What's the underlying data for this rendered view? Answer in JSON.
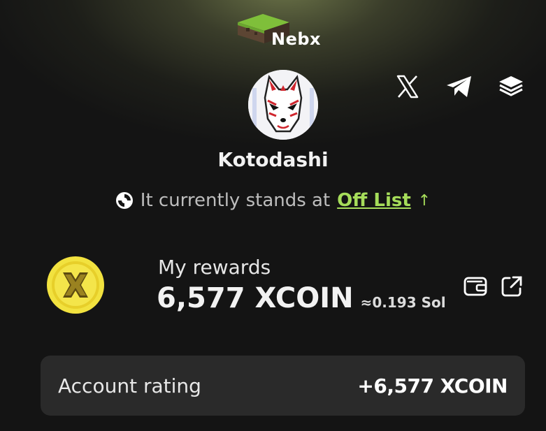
{
  "brand": {
    "name": "Nebx",
    "logo_icon": "grass-block-icon"
  },
  "socials": [
    {
      "name": "x-icon"
    },
    {
      "name": "telegram-icon"
    },
    {
      "name": "layers-icon"
    }
  ],
  "profile": {
    "avatar_icon": "kitsune-mask-icon",
    "username": "Kotodashi"
  },
  "status": {
    "icon": "spinner-icon",
    "text": "It currently stands at",
    "link": "Off List",
    "arrow": "↑",
    "link_color": "#a6dd5a"
  },
  "rewards": {
    "coin_icon": "xcoin-icon",
    "label": "My rewards",
    "amount": "6,577 XCOIN",
    "sol": "≈0.193 Sol",
    "wallet_icon": "wallet-icon",
    "external_icon": "external-link-icon"
  },
  "rating": {
    "label": "Account rating",
    "value": "+6,577 XCOIN"
  },
  "colors": {
    "background": "#141414",
    "card": "#2a2a2a",
    "accent_green": "#a6dd5a",
    "coin_yellow": "#f2e23f"
  }
}
